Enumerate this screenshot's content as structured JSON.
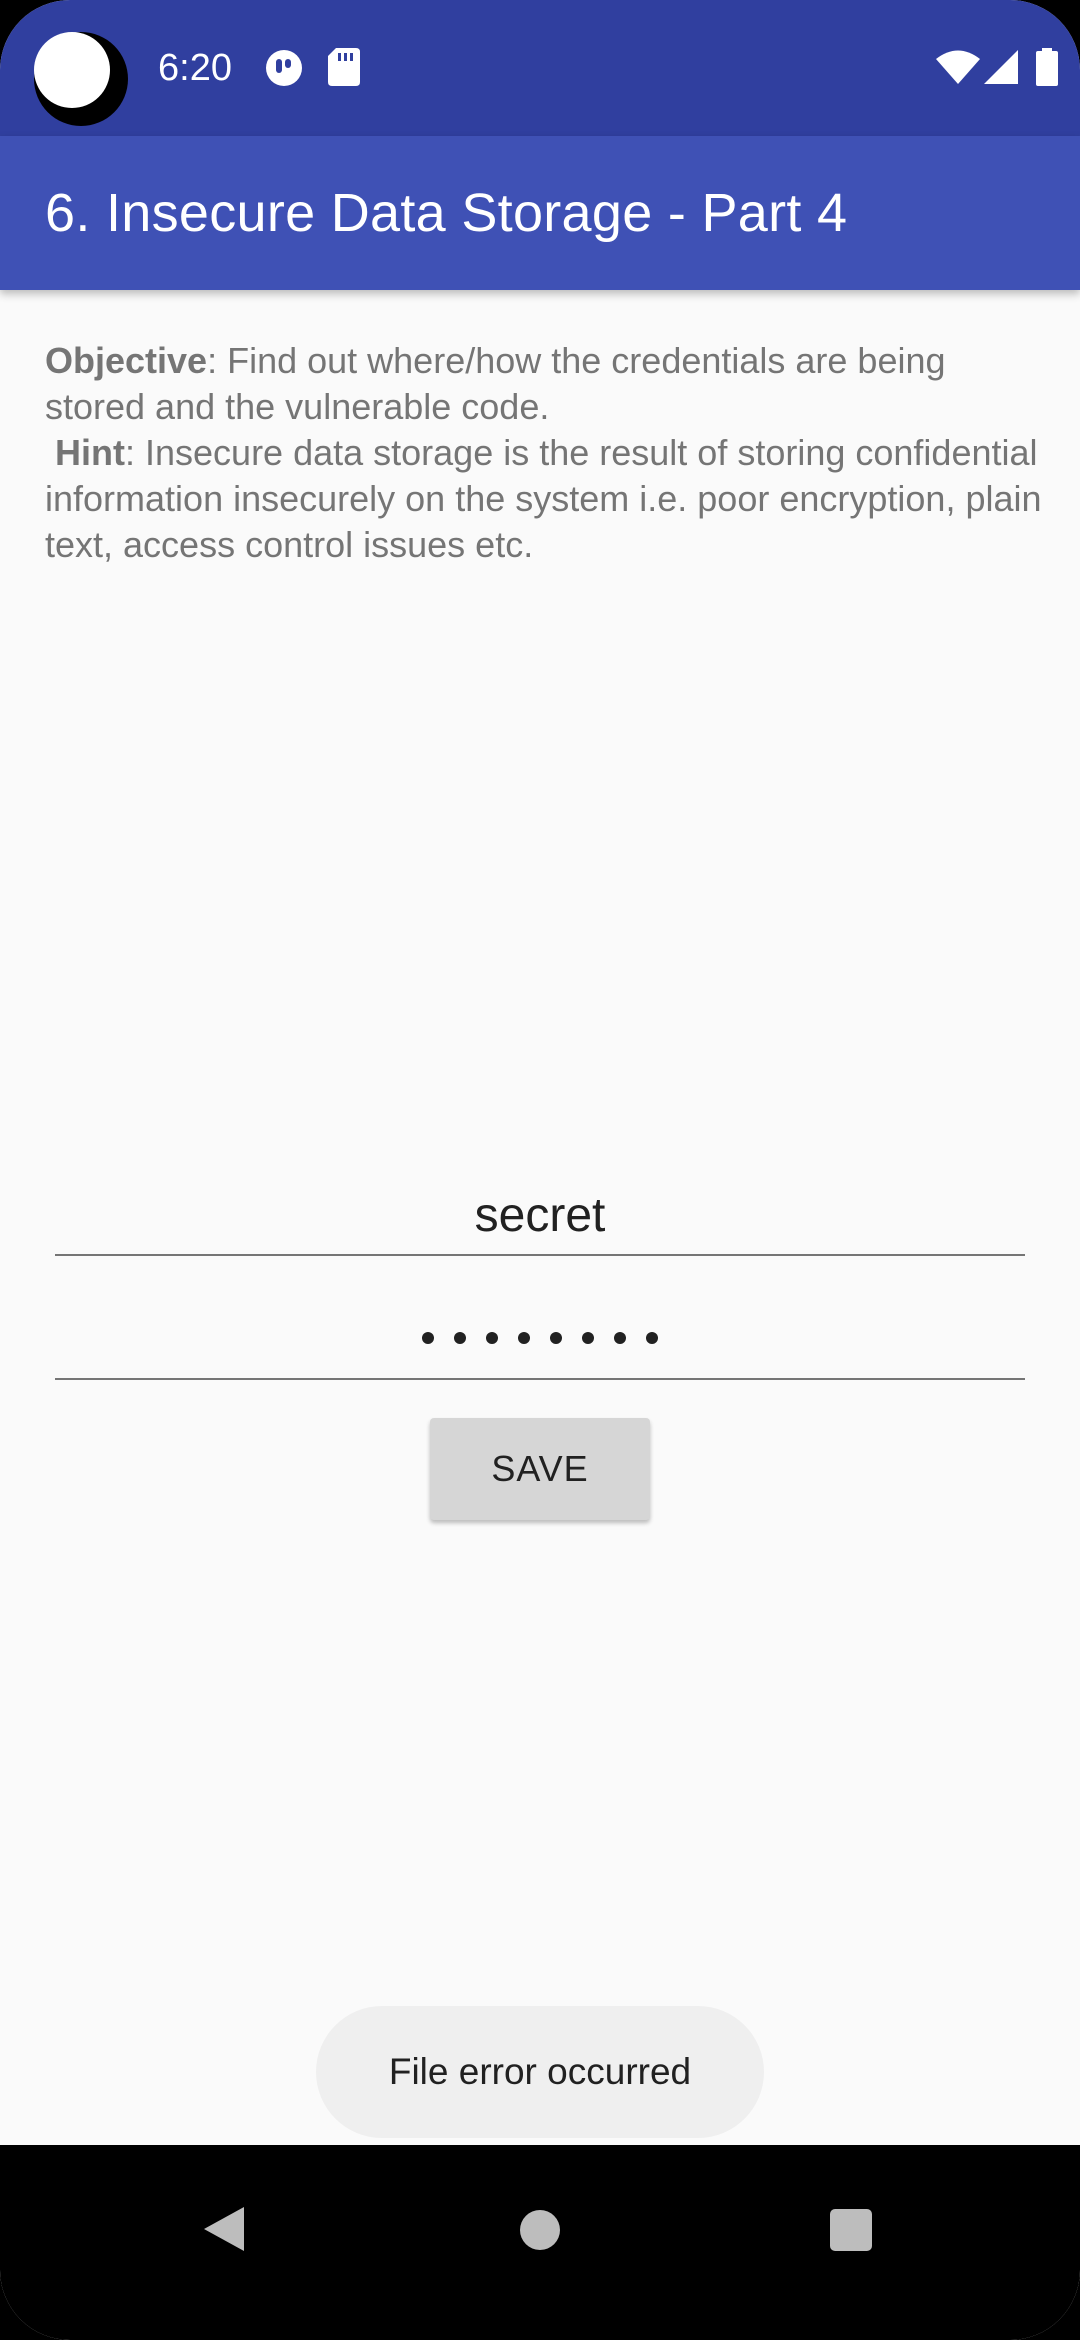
{
  "status_bar": {
    "time": "6:20",
    "icons": [
      "notification-icon",
      "sd-card-icon",
      "wifi-icon",
      "cell-signal-icon",
      "battery-icon"
    ]
  },
  "app_bar": {
    "title": "6. Insecure Data Storage - Part 4"
  },
  "description": {
    "objective_label": "Objective",
    "objective_text": ": Find out where/how the credentials are being stored and the vulnerable code.",
    "hint_label": "Hint",
    "hint_text": ": Insecure data storage is the result of storing confidential information insecurely on the system i.e. poor encryption, plain text, access control issues etc."
  },
  "form": {
    "username_value": "secret",
    "password_value": "••••••••",
    "save_label": "SAVE"
  },
  "toast": {
    "message": "File error occurred"
  },
  "colors": {
    "status_bar": "#303f9f",
    "app_bar": "#3f51b5",
    "background": "#fafafa"
  }
}
